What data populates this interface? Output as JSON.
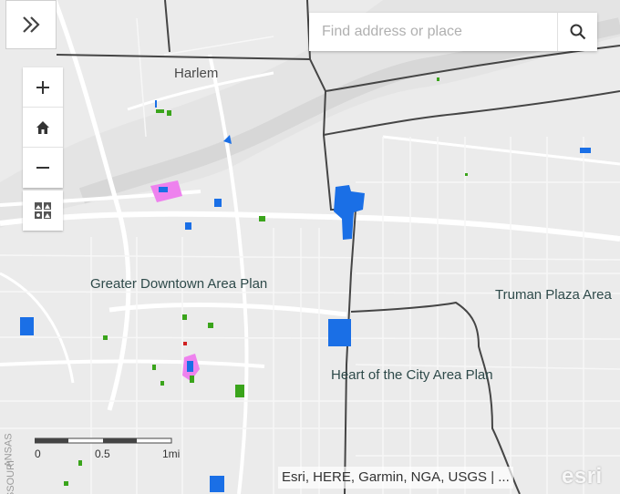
{
  "search": {
    "placeholder": "Find address or place"
  },
  "map": {
    "labels": {
      "harlem": "Harlem",
      "greater_downtown": "Greater Downtown Area Plan",
      "truman_plaza": "Truman Plaza Area",
      "heart_of_city": "Heart of the City Area Plan",
      "kansas_partial": "ANSAS",
      "missouri_partial": "SSOURI"
    }
  },
  "scale": {
    "ticks": [
      "0",
      "0.5",
      "1mi"
    ]
  },
  "attribution": {
    "text": "Esri, HERE, Garmin, NGA, USGS | ..."
  },
  "logo": {
    "text": "esri"
  },
  "colors": {
    "parcel_blue": "#1a6fe6",
    "parcel_green": "#3aa41b",
    "parcel_pink": "#ee82ee",
    "parcel_red": "#d02020",
    "boundary": "#454545"
  }
}
